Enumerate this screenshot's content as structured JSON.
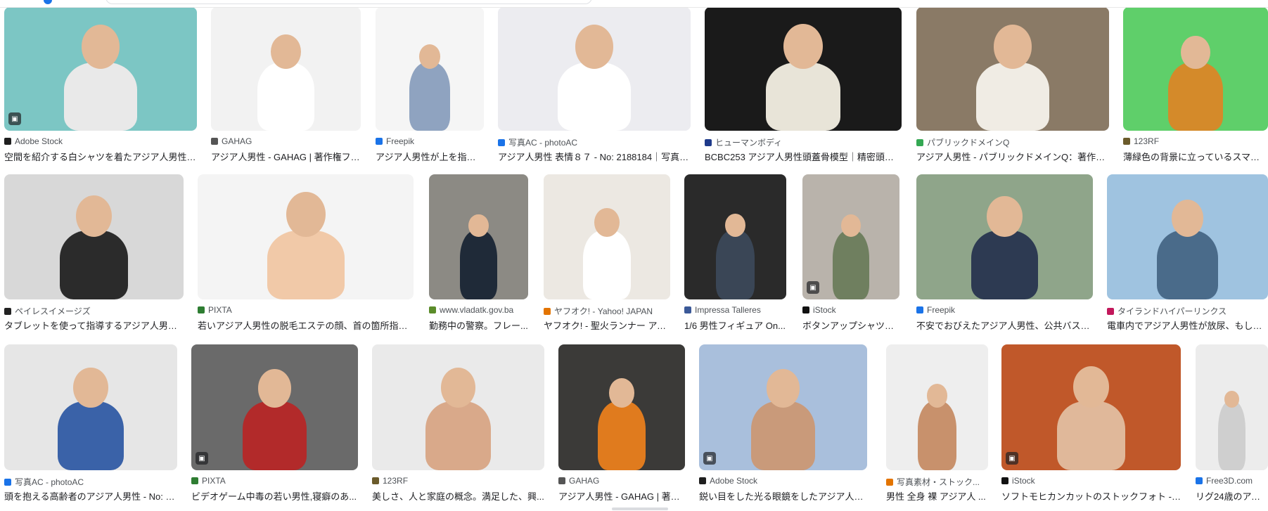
{
  "rows": [
    [
      {
        "source": "Adobe Stock",
        "caption": "空間を紹介する白シャツを着たアジア人男性 S...",
        "src_color": "#1f1f1f",
        "bg": "#7cc6c4",
        "fig": "#e9e9e9",
        "badge": true
      },
      {
        "source": "GAHAG",
        "caption": "アジア人男性 - GAHAG | 著作権フリー...",
        "src_color": "#555555",
        "bg": "#f2f2f2",
        "fig": "#ffffff",
        "badge": false
      },
      {
        "source": "Freepik",
        "caption": "アジア人男性が上を指す ...",
        "src_color": "#1a73e8",
        "bg": "#f5f5f5",
        "fig": "#8fa3c0",
        "badge": false
      },
      {
        "source": "写真AC - photoAC",
        "caption": "アジア人男性 表情８７ - No: 2188184｜写真素...",
        "src_color": "#1a73e8",
        "bg": "#ececf0",
        "fig": "#ffffff",
        "badge": false
      },
      {
        "source": "ヒューマンボディ",
        "caption": "BCBC253 アジア人男性頭蓋骨模型｜精密頭蓋骨...",
        "src_color": "#1e3a8a",
        "bg": "#1a1a1a",
        "fig": "#e8e4d8",
        "badge": false
      },
      {
        "source": "パブリックドメインQ",
        "caption": "アジア人男性 - パブリックドメインQ：著作権...",
        "src_color": "#34a853",
        "bg": "#8a7a66",
        "fig": "#f0ece4",
        "badge": false
      },
      {
        "source": "123RF",
        "caption": "薄緑色の背景に立っているスマートカ...",
        "src_color": "#6b5b2b",
        "bg": "#5fcf6a",
        "fig": "#d48a2a",
        "badge": false
      }
    ],
    [
      {
        "source": "ペイレスイメージズ",
        "caption": "タブレットを使って指導するアジア人男性...",
        "src_color": "#222222",
        "bg": "#d8d8d8",
        "fig": "#2b2b2b",
        "badge": false
      },
      {
        "source": "PIXTA",
        "caption": "若いアジア人男性の脱毛エステの顔、首の箇所指示...",
        "src_color": "#2e7d32",
        "bg": "#f4f4f4",
        "fig": "#f1c9a8",
        "badge": false
      },
      {
        "source": "www.vladatk.gov.ba",
        "caption": "勤務中の警察。フレー...",
        "src_color": "#5b8c2a",
        "bg": "#8c8a84",
        "fig": "#1f2a38",
        "badge": false
      },
      {
        "source": "ヤフオク! - Yahoo! JAPAN",
        "caption": "ヤフオク! - 聖火ランナー アジ...",
        "src_color": "#e37400",
        "bg": "#ece8e2",
        "fig": "#ffffff",
        "badge": false
      },
      {
        "source": "Impressa Talleres",
        "caption": "1/6 男性フィギュア On...",
        "src_color": "#3b5998",
        "bg": "#2a2a2a",
        "fig": "#3a4656",
        "badge": false
      },
      {
        "source": "iStock",
        "caption": "ボタンアップシャツを...",
        "src_color": "#111111",
        "bg": "#b9b3ab",
        "fig": "#6f7f5f",
        "badge": true
      },
      {
        "source": "Freepik",
        "caption": "不安でおびえたアジア人男性、公共バスに...",
        "src_color": "#1a73e8",
        "bg": "#8fa58a",
        "fig": "#2d3a52",
        "badge": false
      },
      {
        "source": "タイランドハイパーリンクス",
        "caption": "電車内でアジア人男性が放尿、もしも新型...",
        "src_color": "#c2185b",
        "bg": "#9fc3e0",
        "fig": "#4a6b8a",
        "badge": false
      }
    ],
    [
      {
        "source": "写真AC - photoAC",
        "caption": "頭を抱える高齢者のアジア人男性 - No: 24...",
        "src_color": "#1a73e8",
        "bg": "#e6e6e6",
        "fig": "#3a62a8",
        "badge": false
      },
      {
        "source": "PIXTA",
        "caption": "ビデオゲーム中毒の若い男性,寝癖のあ...",
        "src_color": "#2e7d32",
        "bg": "#6a6a6a",
        "fig": "#b22a2a",
        "badge": true
      },
      {
        "source": "123RF",
        "caption": "美しさ、人と家庭の概念。満足した、興...",
        "src_color": "#6b5b2b",
        "bg": "#eaeaea",
        "fig": "#d9a98a",
        "badge": false
      },
      {
        "source": "GAHAG",
        "caption": "アジア人男性 - GAHAG | 著作...",
        "src_color": "#555555",
        "bg": "#3b3a38",
        "fig": "#e07b1e",
        "badge": false
      },
      {
        "source": "Adobe Stock",
        "caption": "鋭い目をした光る眼鏡をしたアジア人男...",
        "src_color": "#1f1f1f",
        "bg": "#a9bfdc",
        "fig": "#c99a7a",
        "badge": true
      },
      {
        "source": "写真素材・ストック...",
        "caption": "男性 全身 裸 アジア人 ...",
        "src_color": "#e37400",
        "bg": "#eeeeee",
        "fig": "#c8916c",
        "badge": false
      },
      {
        "source": "iStock",
        "caption": "ソフトモヒカンカットのストックフォト - i...",
        "src_color": "#111111",
        "bg": "#c0582a",
        "fig": "#e0b89a",
        "badge": true
      },
      {
        "source": "Free3D.com",
        "caption": "リグ24歳のアジア...",
        "src_color": "#1a73e8",
        "bg": "#ececec",
        "fig": "#cfcfcf",
        "badge": false
      }
    ]
  ]
}
